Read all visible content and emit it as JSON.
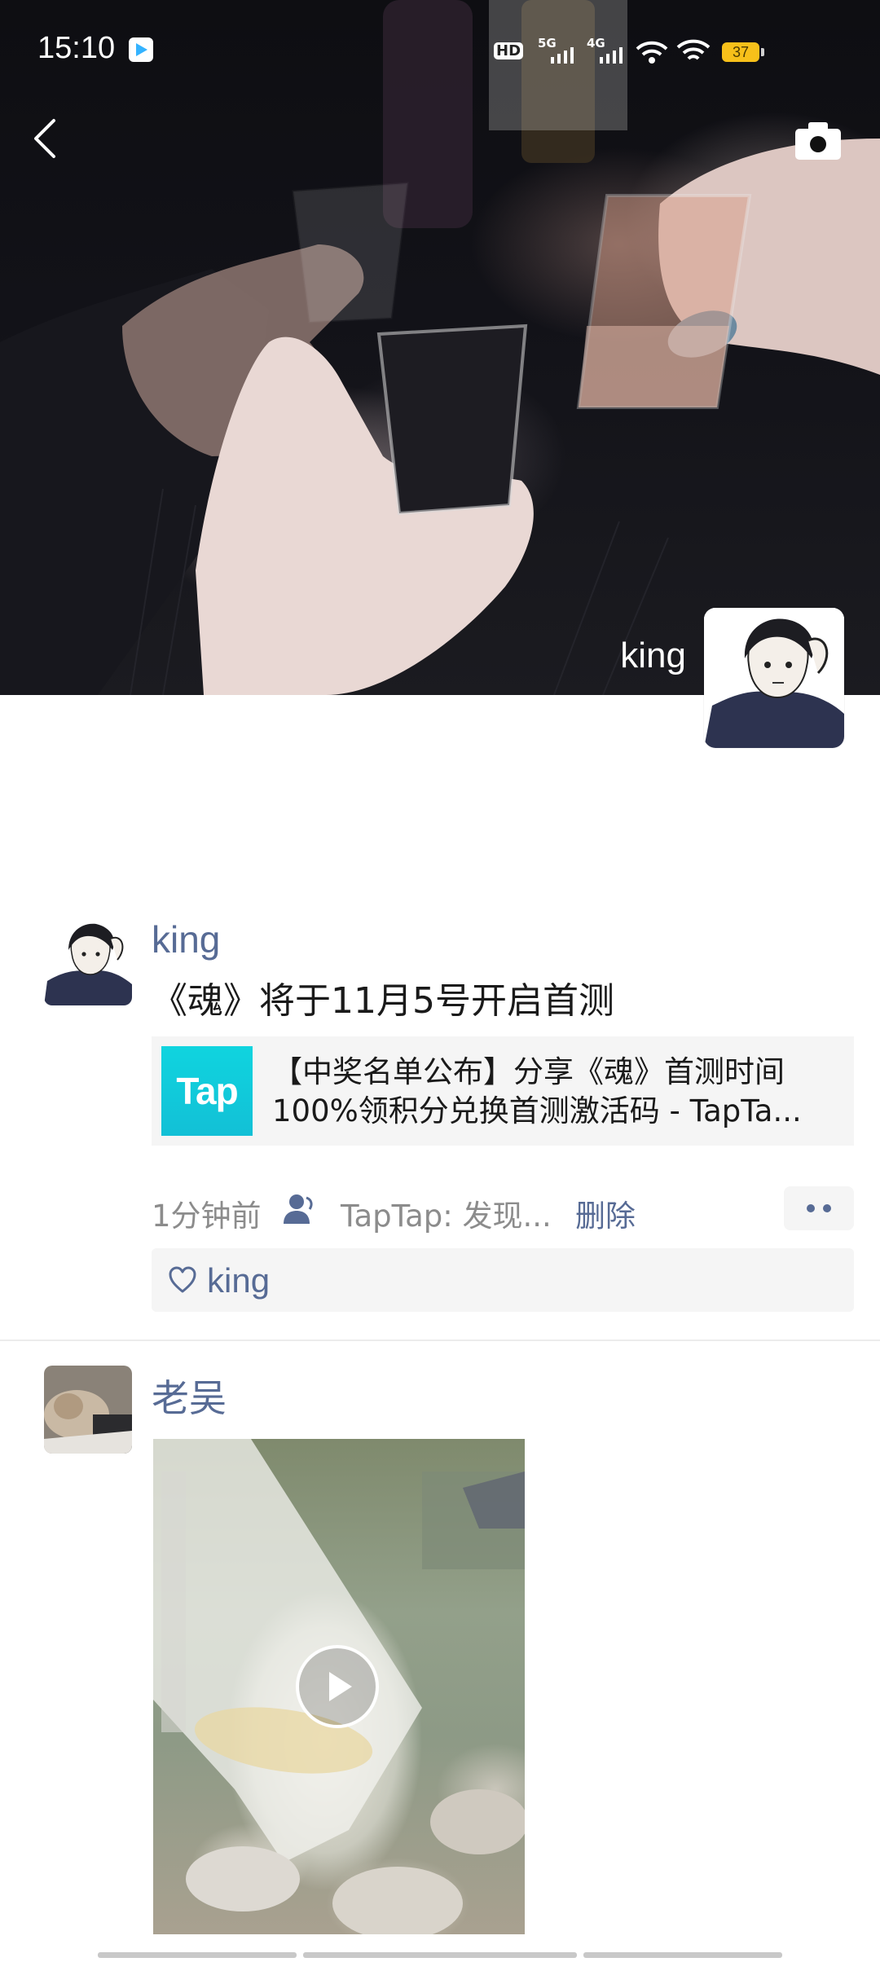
{
  "status_bar": {
    "time": "15:10",
    "network_hd": "HD",
    "network_5g": "5G",
    "network_4g": "4G",
    "battery": "37"
  },
  "cover": {
    "username": "king"
  },
  "icons": {
    "back": "back-arrow-icon",
    "camera": "camera-icon",
    "visibility": "friends-visible-icon",
    "like": "heart-icon",
    "more": "more-dots-icon",
    "play": "play-icon"
  },
  "colors": {
    "link": "#576b95",
    "meta": "#8c8c8c",
    "card_bg": "#f5f5f5",
    "tap_brand": "#12c8da",
    "battery": "#f7c01a"
  },
  "posts": [
    {
      "username": "king",
      "text": "《魂》将于11月5号开启首测",
      "share_card": {
        "logo_text": "Tap",
        "title_line1": "【中奖名单公布】分享《魂》首测时间",
        "title_line2": "100%领积分兑换首测激活码 - TapTa..."
      },
      "time": "1分钟前",
      "source": "TapTap: 发现...",
      "delete_label": "删除",
      "likes": "king"
    },
    {
      "username": "老吴",
      "media": "video"
    }
  ]
}
